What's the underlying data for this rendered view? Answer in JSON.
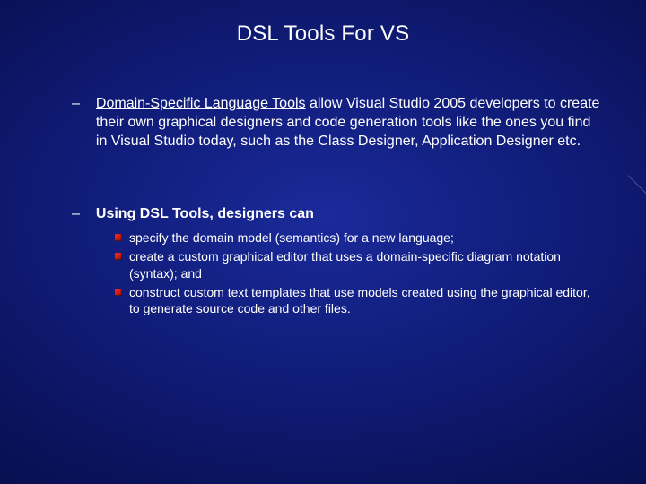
{
  "title": "DSL Tools For VS",
  "paragraph1": {
    "link_text": "Domain-Specific Language Tools",
    "rest": " allow Visual Studio 2005 developers to create their own graphical designers and code generation tools like the ones you find in Visual Studio today, such as the Class Designer, Application Designer etc."
  },
  "paragraph2": "Using DSL Tools, designers can",
  "subitems": [
    "specify the domain model (semantics) for a new language;",
    "create a custom graphical editor that uses a domain-specific diagram notation (syntax); and",
    "construct custom text templates that use models created using the graphical editor, to generate source code and other files."
  ]
}
